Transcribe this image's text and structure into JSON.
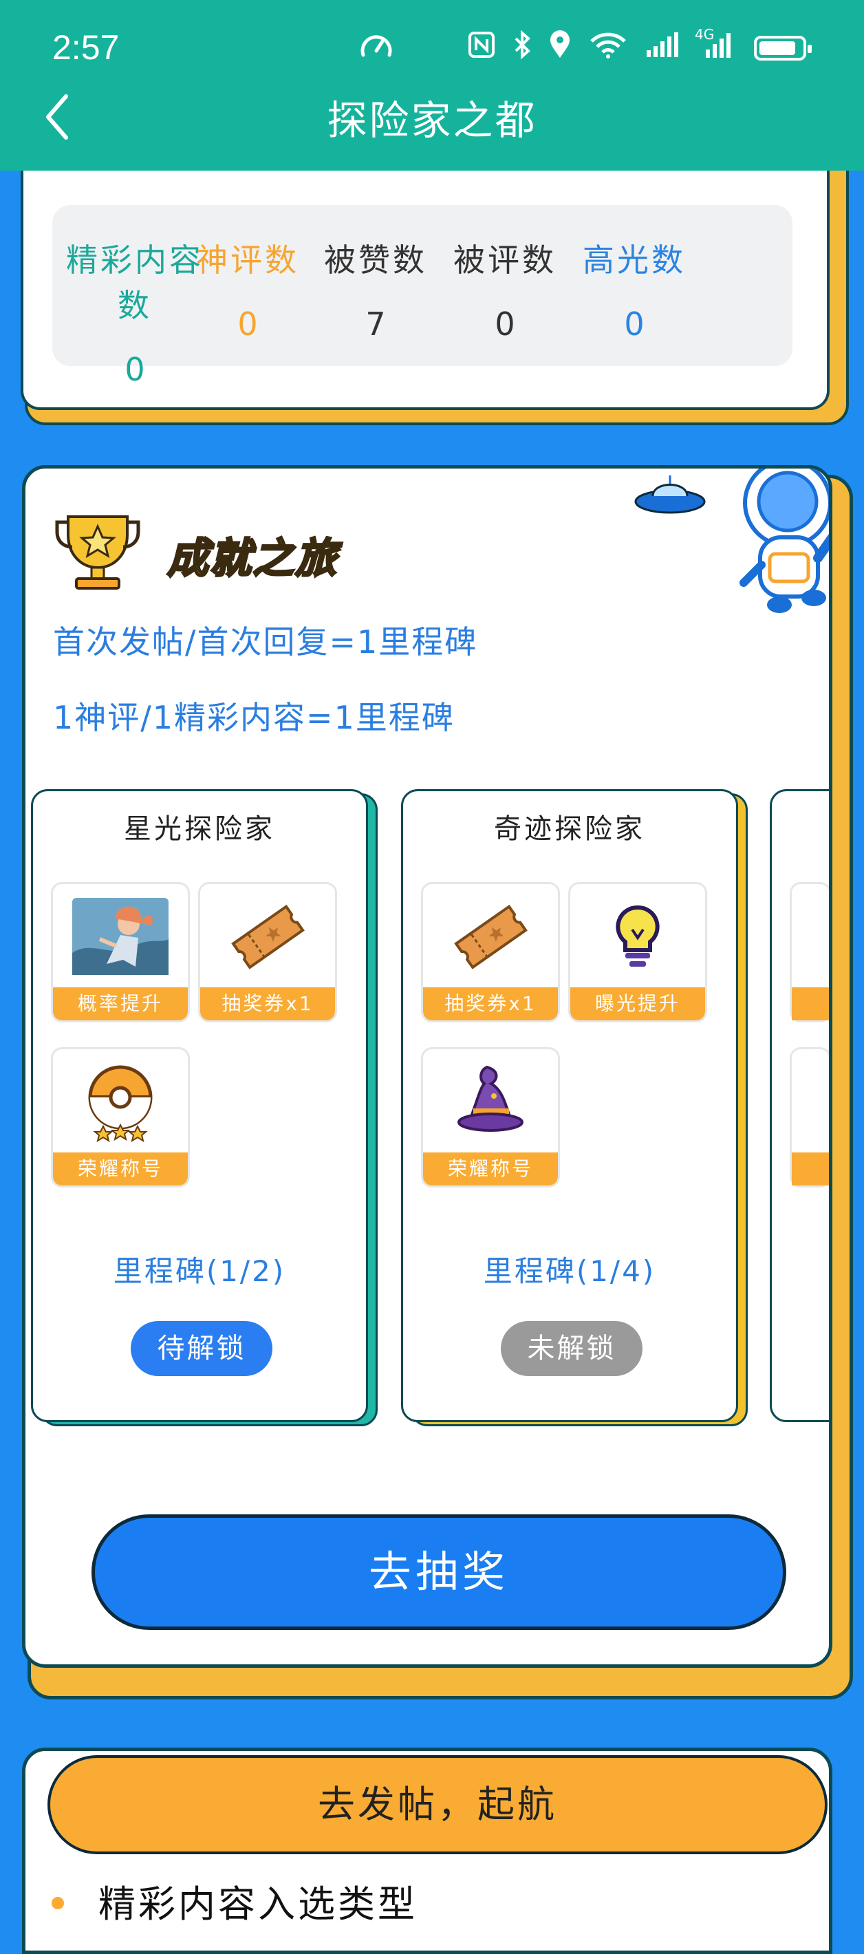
{
  "status_bar": {
    "time": "2:57",
    "network": "4G",
    "sim_indicator": "6"
  },
  "header": {
    "title": "探险家之都"
  },
  "stats": [
    {
      "label": "精彩内容数",
      "value": "0",
      "color": "#1aa99a"
    },
    {
      "label": "神评数",
      "value": "0",
      "color": "#f6a531"
    },
    {
      "label": "被赞数",
      "value": "7",
      "color": "#333333"
    },
    {
      "label": "被评数",
      "value": "0",
      "color": "#333333"
    },
    {
      "label": "高光数",
      "value": "0",
      "color": "#2a84e0"
    }
  ],
  "achievement": {
    "title": "成就之旅",
    "rules": [
      "首次发帖/首次回复=1里程碑",
      "1神评/1精彩内容=1里程碑"
    ],
    "milestones": [
      {
        "title": "星光探险家",
        "rewards": [
          {
            "label": "概率提升",
            "icon": "character-skin-image"
          },
          {
            "label": "抽奖券x1",
            "icon": "ticket-icon"
          },
          {
            "label": "荣耀称号",
            "icon": "badge-icon"
          }
        ],
        "progress": "里程碑(1/2)",
        "button": "待解锁",
        "button_color": "#2a7ef2"
      },
      {
        "title": "奇迹探险家",
        "rewards": [
          {
            "label": "抽奖券x1",
            "icon": "ticket-icon"
          },
          {
            "label": "曝光提升",
            "icon": "lightbulb-icon"
          },
          {
            "label": "荣耀称号",
            "icon": "wizard-hat-icon"
          }
        ],
        "progress": "里程碑(1/4)",
        "button": "未解锁",
        "button_color": "#9a9a9a"
      }
    ],
    "lottery_button": "去抽奖"
  },
  "post": {
    "button": "去发帖，起航",
    "section_title": "精彩内容入选类型"
  }
}
